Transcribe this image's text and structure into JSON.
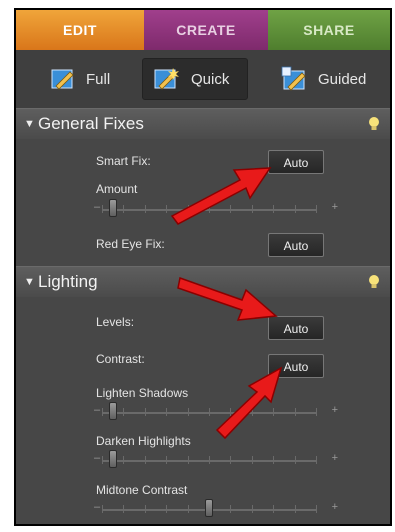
{
  "tabs": {
    "edit": "EDIT",
    "create": "CREATE",
    "share": "SHARE"
  },
  "modes": {
    "full": "Full",
    "quick": "Quick",
    "guided": "Guided"
  },
  "general_fixes": {
    "title": "General Fixes",
    "smart_fix_label": "Smart Fix:",
    "smart_fix_button": "Auto",
    "amount_label": "Amount",
    "amount_value": 0.05,
    "red_eye_label": "Red Eye Fix:",
    "red_eye_button": "Auto"
  },
  "lighting": {
    "title": "Lighting",
    "levels_label": "Levels:",
    "levels_button": "Auto",
    "contrast_label": "Contrast:",
    "contrast_button": "Auto",
    "lighten_shadows_label": "Lighten Shadows",
    "lighten_shadows_value": 0.05,
    "darken_highlights_label": "Darken Highlights",
    "darken_highlights_value": 0.05,
    "midtone_contrast_label": "Midtone Contrast",
    "midtone_contrast_value": 0.5
  },
  "slider_symbols": {
    "minus": "–",
    "plus": "+"
  },
  "colors": {
    "edit_tab": "#e8902a",
    "create_tab": "#8f3580",
    "share_tab": "#5f9139",
    "arrow": "#e81a1a",
    "bulb": "#f7e27a"
  }
}
